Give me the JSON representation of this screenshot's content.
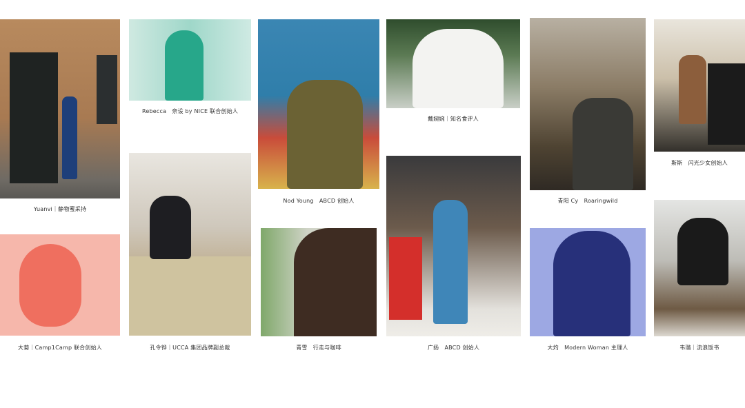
{
  "profiles": [
    {
      "caption": "Yuanvi｜静物蜜采持"
    },
    {
      "caption": "Rebecca　奈设 by NICE 联合创始人"
    },
    {
      "caption": "Nod Young　ABCD 创始人"
    },
    {
      "caption": "戴婉婉｜知名食评人"
    },
    {
      "caption": "青阳 Cy　Roaringwild"
    },
    {
      "caption": "斯斯　闪光少女创始人"
    },
    {
      "caption": "大菊｜Camp1Camp 联合创始人"
    },
    {
      "caption": "孔令铧｜UCCA 集团品牌副总裁"
    },
    {
      "caption": "青雪　行走与咖啡"
    },
    {
      "caption": "广扬　ABCD 创始人"
    },
    {
      "caption": "大灼　Modern Woman 主理人"
    },
    {
      "caption": "韦璐｜流浪饭书"
    }
  ],
  "colors": {
    "background": "#ffffff",
    "caption_text": "#333333",
    "coral_tint": "#ef6f5f",
    "blue_tint": "#27307a",
    "teal_tint": "#27a78a"
  }
}
